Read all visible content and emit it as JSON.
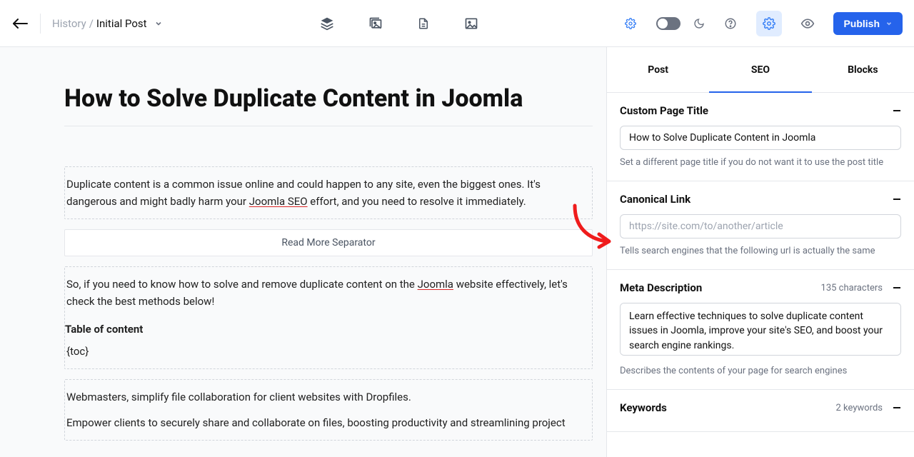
{
  "breadcrumb": {
    "history": "History",
    "sep": " / ",
    "current": "Initial Post"
  },
  "publish": {
    "label": "Publish"
  },
  "tabs": {
    "post": "Post",
    "seo": "SEO",
    "blocks": "Blocks"
  },
  "editor": {
    "title": "How to Solve Duplicate Content in Joomla",
    "p1a": "Duplicate content is a common issue online and could happen to any site, even the biggest ones. It's dangerous and might badly harm your ",
    "p1b": "Joomla SEO",
    "p1c": " effort, and you need to resolve it immediately.",
    "readmore": "Read More Separator",
    "p2a": "So, if you need to know how to solve and remove duplicate content on the ",
    "p2b": "Joomla",
    "p2c": " website effectively, let's check the best methods below!",
    "toc_header": "Table of content",
    "toc_code": "{toc}",
    "p3": "Webmasters, simplify file collaboration for client websites with Dropfiles.",
    "p4": "Empower clients to securely share and collaborate on files, boosting productivity and streamlining project"
  },
  "seo": {
    "custom_title": {
      "label": "Custom Page Title",
      "value": "How to Solve Duplicate Content in Joomla",
      "hint": "Set a different page title if you do not want it to use the post title"
    },
    "canonical": {
      "label": "Canonical Link",
      "placeholder": "https://site.com/to/another/article",
      "hint": "Tells search engines that the following url is actually the same"
    },
    "meta_desc": {
      "label": "Meta Description",
      "count": "135 characters",
      "value": "Learn effective techniques to solve duplicate content issues in Joomla, improve your site's SEO, and boost your search engine rankings.",
      "hint": "Describes the contents of your page for search engines"
    },
    "keywords": {
      "label": "Keywords",
      "count": "2 keywords"
    }
  }
}
